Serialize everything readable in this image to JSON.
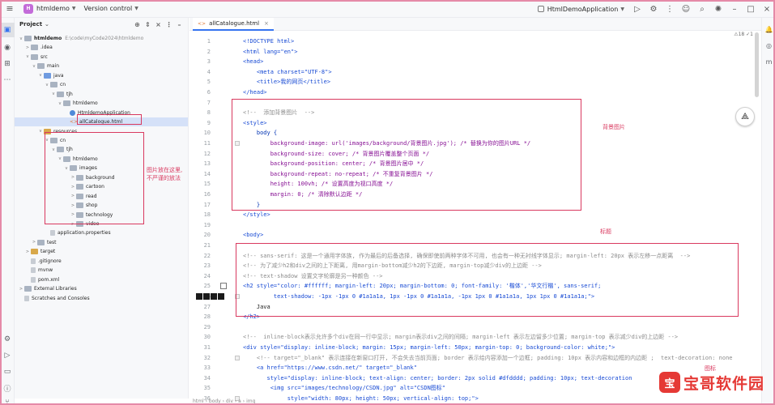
{
  "titlebar": {
    "menu_icon": "hamburger-icon",
    "project_badge": "H",
    "project_name": "htmldemo",
    "vcs_label": "Version control",
    "run_config": "HtmlDemoApplication",
    "icons": [
      "run-icon",
      "debug-icon",
      "more-icon",
      "users-icon",
      "search-icon",
      "settings-icon",
      "minimize-icon",
      "maximize-icon",
      "close-icon"
    ]
  },
  "project_panel": {
    "title": "Project",
    "chevron": "⌄",
    "tree": [
      {
        "depth": 0,
        "twisty": "v",
        "icon": "folder",
        "label": "htmldemo",
        "extra": "E:\\code\\myCode2024\\htmldemo",
        "bold": true
      },
      {
        "depth": 1,
        "twisty": ">",
        "icon": "folder",
        "label": ".idea"
      },
      {
        "depth": 1,
        "twisty": "v",
        "icon": "folder",
        "label": "src"
      },
      {
        "depth": 2,
        "twisty": "v",
        "icon": "folder",
        "label": "main"
      },
      {
        "depth": 3,
        "twisty": "v",
        "icon": "folder-blue",
        "label": "java"
      },
      {
        "depth": 4,
        "twisty": "v",
        "icon": "folder",
        "label": "cn"
      },
      {
        "depth": 5,
        "twisty": "v",
        "icon": "folder",
        "label": "tjh"
      },
      {
        "depth": 6,
        "twisty": "v",
        "icon": "folder",
        "label": "htmldemo"
      },
      {
        "depth": 7,
        "twisty": "",
        "icon": "java",
        "label": "HtmldemoApplication"
      },
      {
        "depth": 7,
        "twisty": "",
        "icon": "html",
        "label": "allCatalogue.html",
        "selected": true
      },
      {
        "depth": 3,
        "twisty": "v",
        "icon": "folder-orange",
        "label": "resources"
      },
      {
        "depth": 4,
        "twisty": "v",
        "icon": "folder",
        "label": "cn"
      },
      {
        "depth": 5,
        "twisty": "v",
        "icon": "folder",
        "label": "tjh"
      },
      {
        "depth": 6,
        "twisty": "v",
        "icon": "folder",
        "label": "htmldemo"
      },
      {
        "depth": 7,
        "twisty": "v",
        "icon": "folder",
        "label": "images"
      },
      {
        "depth": 8,
        "twisty": ">",
        "icon": "folder",
        "label": "background"
      },
      {
        "depth": 8,
        "twisty": ">",
        "icon": "folder",
        "label": "cartoon"
      },
      {
        "depth": 8,
        "twisty": ">",
        "icon": "folder",
        "label": "read"
      },
      {
        "depth": 8,
        "twisty": ">",
        "icon": "folder",
        "label": "shop"
      },
      {
        "depth": 8,
        "twisty": ">",
        "icon": "folder",
        "label": "technology"
      },
      {
        "depth": 8,
        "twisty": ">",
        "icon": "folder",
        "label": "video"
      },
      {
        "depth": 4,
        "twisty": "",
        "icon": "file",
        "label": "application.properties"
      },
      {
        "depth": 2,
        "twisty": ">",
        "icon": "folder",
        "label": "test"
      },
      {
        "depth": 1,
        "twisty": ">",
        "icon": "folder-orange",
        "label": "target"
      },
      {
        "depth": 1,
        "twisty": "",
        "icon": "file",
        "label": ".gitignore"
      },
      {
        "depth": 1,
        "twisty": "",
        "icon": "file",
        "label": "mvnw"
      },
      {
        "depth": 1,
        "twisty": "",
        "icon": "file",
        "label": "pom.xml"
      },
      {
        "depth": 0,
        "twisty": ">",
        "icon": "folder",
        "label": "External Libraries"
      },
      {
        "depth": 0,
        "twisty": "",
        "icon": "file",
        "label": "Scratches and Consoles"
      }
    ],
    "annotation": "图片放在这里,\n不严谨的放法"
  },
  "editor": {
    "tab_prefix": "<>",
    "tab_label": "allCatalogue.html",
    "tab_close": "×",
    "warnings": "⚠18 ✓1",
    "lines": [
      {
        "n": "1",
        "text": "<!DOCTYPE html>",
        "cls": "tagc"
      },
      {
        "n": "2",
        "text": "<html lang=\"en\">",
        "cls": "tagc"
      },
      {
        "n": "3",
        "text": "<head>",
        "cls": "tagc"
      },
      {
        "n": "4",
        "text": "    <meta charset=\"UTF-8\">",
        "cls": "tagc"
      },
      {
        "n": "5",
        "text": "    <title>我的网页</title>",
        "cls": "tagc"
      },
      {
        "n": "6",
        "text": "</head>",
        "cls": "tagc"
      },
      {
        "n": "7",
        "text": "",
        "cls": ""
      },
      {
        "n": "8",
        "text": "<!--  添加背景图片  -->",
        "cls": "cmt"
      },
      {
        "n": "9",
        "text": "<style>",
        "cls": "tagc"
      },
      {
        "n": "10",
        "text": "    body {",
        "cls": "kw"
      },
      {
        "n": "11",
        "text": "        background-image: url('images/background/背景图片.jpg'); /* 替换为你的图片URL */",
        "cls": "prop"
      },
      {
        "n": "12",
        "text": "        background-size: cover; /* 背景图片覆盖整个页面 */",
        "cls": "prop"
      },
      {
        "n": "13",
        "text": "        background-position: center; /* 背景图片居中 */",
        "cls": "prop"
      },
      {
        "n": "14",
        "text": "        background-repeat: no-repeat; /* 不重复背景图片 */",
        "cls": "prop"
      },
      {
        "n": "15",
        "text": "        height: 100vh; /* 设置高度为视口高度 */",
        "cls": "prop"
      },
      {
        "n": "16",
        "text": "        margin: 0; /* 清除默认边距 */",
        "cls": "prop"
      },
      {
        "n": "17",
        "text": "    }",
        "cls": "kw"
      },
      {
        "n": "18",
        "text": "</style>",
        "cls": "tagc"
      },
      {
        "n": "19",
        "text": "",
        "cls": ""
      },
      {
        "n": "20",
        "text": "<body>",
        "cls": "tagc"
      },
      {
        "n": "21",
        "text": "",
        "cls": ""
      },
      {
        "n": "22",
        "text": "<!-- sans-serif: 这是一个通用字体族, 作为最后的后备选择, 确保即使前两种字体不可用, 也会有一种无衬线字体显示; margin-left: 20px 表示左移一点距离  -->",
        "cls": "cmt"
      },
      {
        "n": "23",
        "text": "<!-- 为了减少h2和div之间的上下距离, 用margin-bottom减少h2的下边距, margin-top减少div的上边距 -->",
        "cls": "cmt"
      },
      {
        "n": "24",
        "text": "<!-- text-shadow 设置文字轮廓是另一种颜色 -->",
        "cls": "cmt"
      },
      {
        "n": "25",
        "text": "<h2 style=\"color: #ffffff; margin-left: 20px; margin-bottom: 0; font-family: '楷体','华文行楷', sans-serif;",
        "cls": "tagc"
      },
      {
        "n": "26",
        "text": "         text-shadow: -1px -1px 0 #1a1a1a, 1px -1px 0 #1a1a1a, -1px 1px 0 #1a1a1a, 1px 1px 0 #1a1a1a;\">",
        "cls": "tagc"
      },
      {
        "n": "27",
        "text": "    Java",
        "cls": ""
      },
      {
        "n": "28",
        "text": "</h2>",
        "cls": "tagc"
      },
      {
        "n": "29",
        "text": "",
        "cls": ""
      },
      {
        "n": "30",
        "text": "<!--  inline-block表示允许多个div在同一行中显示; margin表示div之间的间隔; margin-left 表示左边留多少位置; margin-top 表示减少div的上边距 -->",
        "cls": "cmt"
      },
      {
        "n": "31",
        "text": "<div style=\"display: inline-block; margin: 15px; margin-left: 50px; margin-top: 0; background-color: white;\">",
        "cls": "tagc"
      },
      {
        "n": "32",
        "text": "    <!-- target=\"_blank\" 表示连接在新窗口打开, 不会失去当前页面; border 表示给内容添加一个边框; padding: 10px 表示内容和边框的内边距 ;  text-decoration: none",
        "cls": "cmt"
      },
      {
        "n": "33",
        "text": "    <a href=\"https://www.csdn.net/\" target=\"_blank\"",
        "cls": "tagc"
      },
      {
        "n": "34",
        "text": "       style=\"display: inline-block; text-align: center; border: 2px solid #dfdddd; padding: 10px; text-decoration",
        "cls": "tagc"
      },
      {
        "n": "35",
        "text": "        <img src=\"images/technology/CSDN.jpg\" alt=\"CSDN图标\"",
        "cls": "tagc"
      },
      {
        "n": "36",
        "text": "             style=\"width: 80px; height: 50px; vertical-align: top;\">",
        "cls": "tagc"
      }
    ],
    "annotations": {
      "bg": "背景图片",
      "title": "标题",
      "icon": "图标"
    }
  },
  "statusbar": {
    "text": "html › body › div › a › img"
  },
  "watermark": {
    "logo": "宝",
    "text": "宝哥软件园"
  },
  "colors": {
    "accent": "#3574f0",
    "annotation": "#d9395f",
    "watermark": "#e53935"
  }
}
